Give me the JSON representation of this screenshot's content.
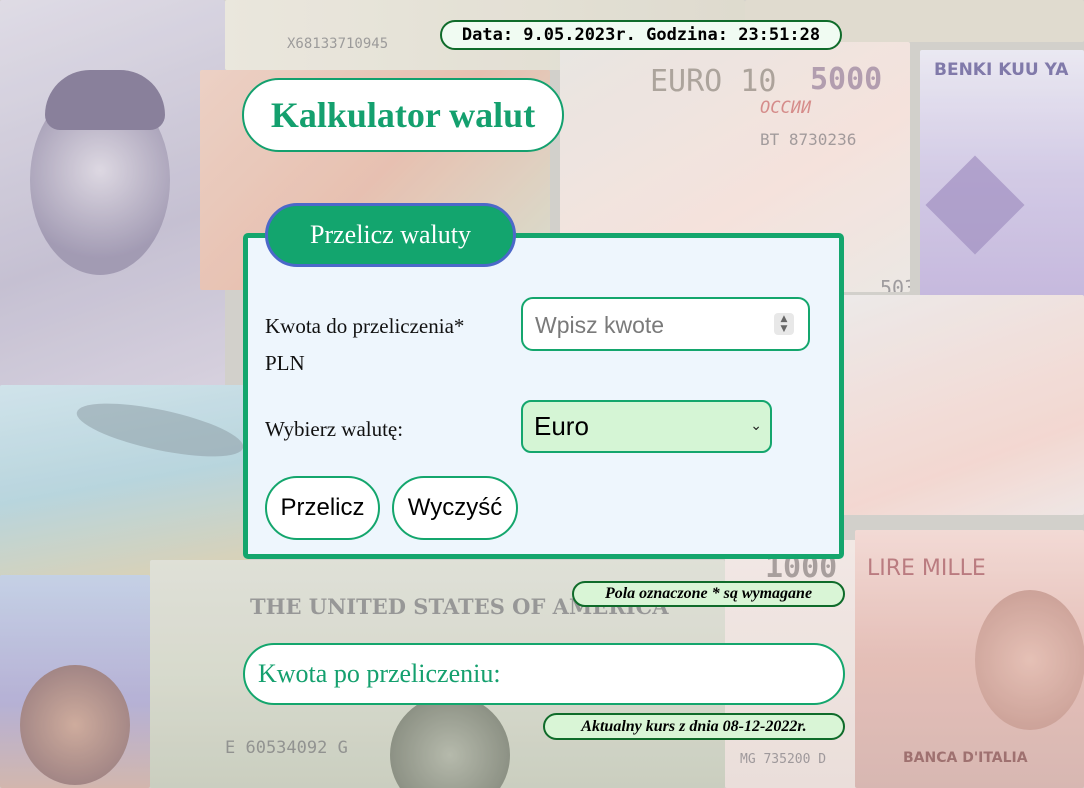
{
  "header": {
    "datetime": "Data: 9.05.2023r. Godzina: 23:51:28",
    "title": "Kalkulator walut"
  },
  "converter": {
    "tab_label": "Przelicz waluty",
    "amount_label": "Kwota do przeliczenia*",
    "amount_unit": "PLN",
    "amount_placeholder": "Wpisz kwote",
    "amount_value": "",
    "currency_label": "Wybierz walutę:",
    "currency_selected": "Euro",
    "convert_button": "Przelicz",
    "clear_button": "Wyczyść"
  },
  "required_note": "Pola oznaczone * są wymagane",
  "result": {
    "label": "Kwota po przeliczeniu:"
  },
  "rate_note": "Aktualny kurs z dnia 08-12-2022r.",
  "background": {
    "texts": [
      "X68133710945",
      "EURO 10",
      "5000",
      "BENKI KUU YA",
      "ОССИИ",
      "BT 8730236",
      "503",
      "THE UNITED STATES OF AMERICA",
      "E 60534092 G",
      "LIRE MILLE",
      "BANCA D'ITALIA",
      "MG 735200 D",
      "1000"
    ]
  },
  "colors": {
    "accent": "#14a66d",
    "pill_border": "#0f6b2a",
    "select_bg": "#d5f5d5",
    "panel_bg": "#eef6fd",
    "tab_border": "#4c68c9"
  }
}
